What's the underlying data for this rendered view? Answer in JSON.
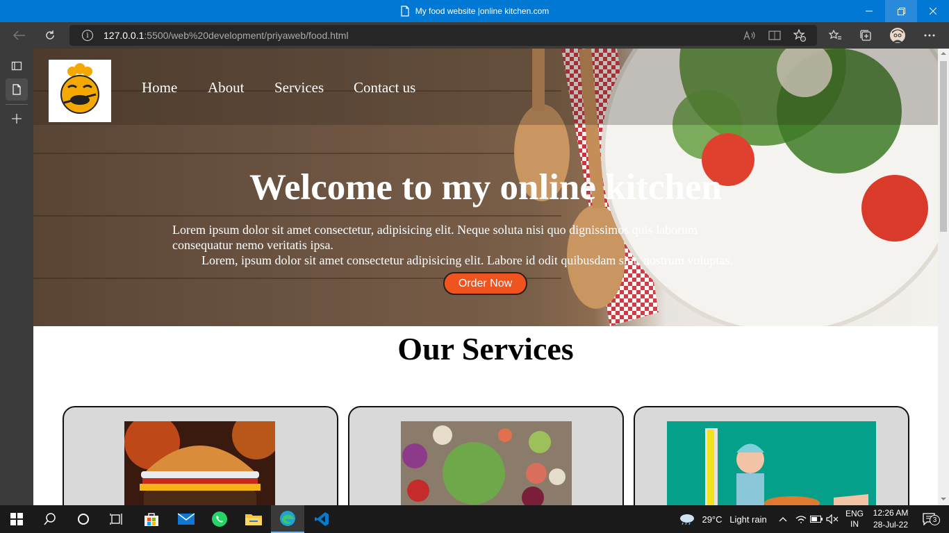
{
  "window": {
    "title": "My food website |online kitchen.com"
  },
  "browser": {
    "url_host": "127.0.0.1",
    "url_path": ":5500/web%20development/priyaweb/food.html"
  },
  "site": {
    "nav": [
      {
        "label": "Home"
      },
      {
        "label": "About"
      },
      {
        "label": "Services"
      },
      {
        "label": "Contact us"
      }
    ],
    "hero": {
      "title": "Welcome to my online kitchen",
      "line1": "Lorem ipsum dolor sit amet consectetur, adipisicing elit. Neque soluta nisi quo dignissimos quis laborum",
      "line2": "consequatur nemo veritatis ipsa.",
      "line3": "Lorem, ipsum dolor sit amet consectetur adipisicing elit. Labore id odit quibusdam sint, nostrum voluptas.",
      "button": "Order Now"
    },
    "services_heading": "Our Services"
  },
  "taskbar": {
    "weather_temp": "29°C",
    "weather_text": "Light rain",
    "lang_line1": "ENG",
    "lang_line2": "IN",
    "time": "12:26 AM",
    "date": "28-Jul-22",
    "notification_count": "3"
  },
  "colors": {
    "titlebar": "#0078d4",
    "order_button": "#f0541e",
    "card_bg": "#d9d9d9"
  }
}
